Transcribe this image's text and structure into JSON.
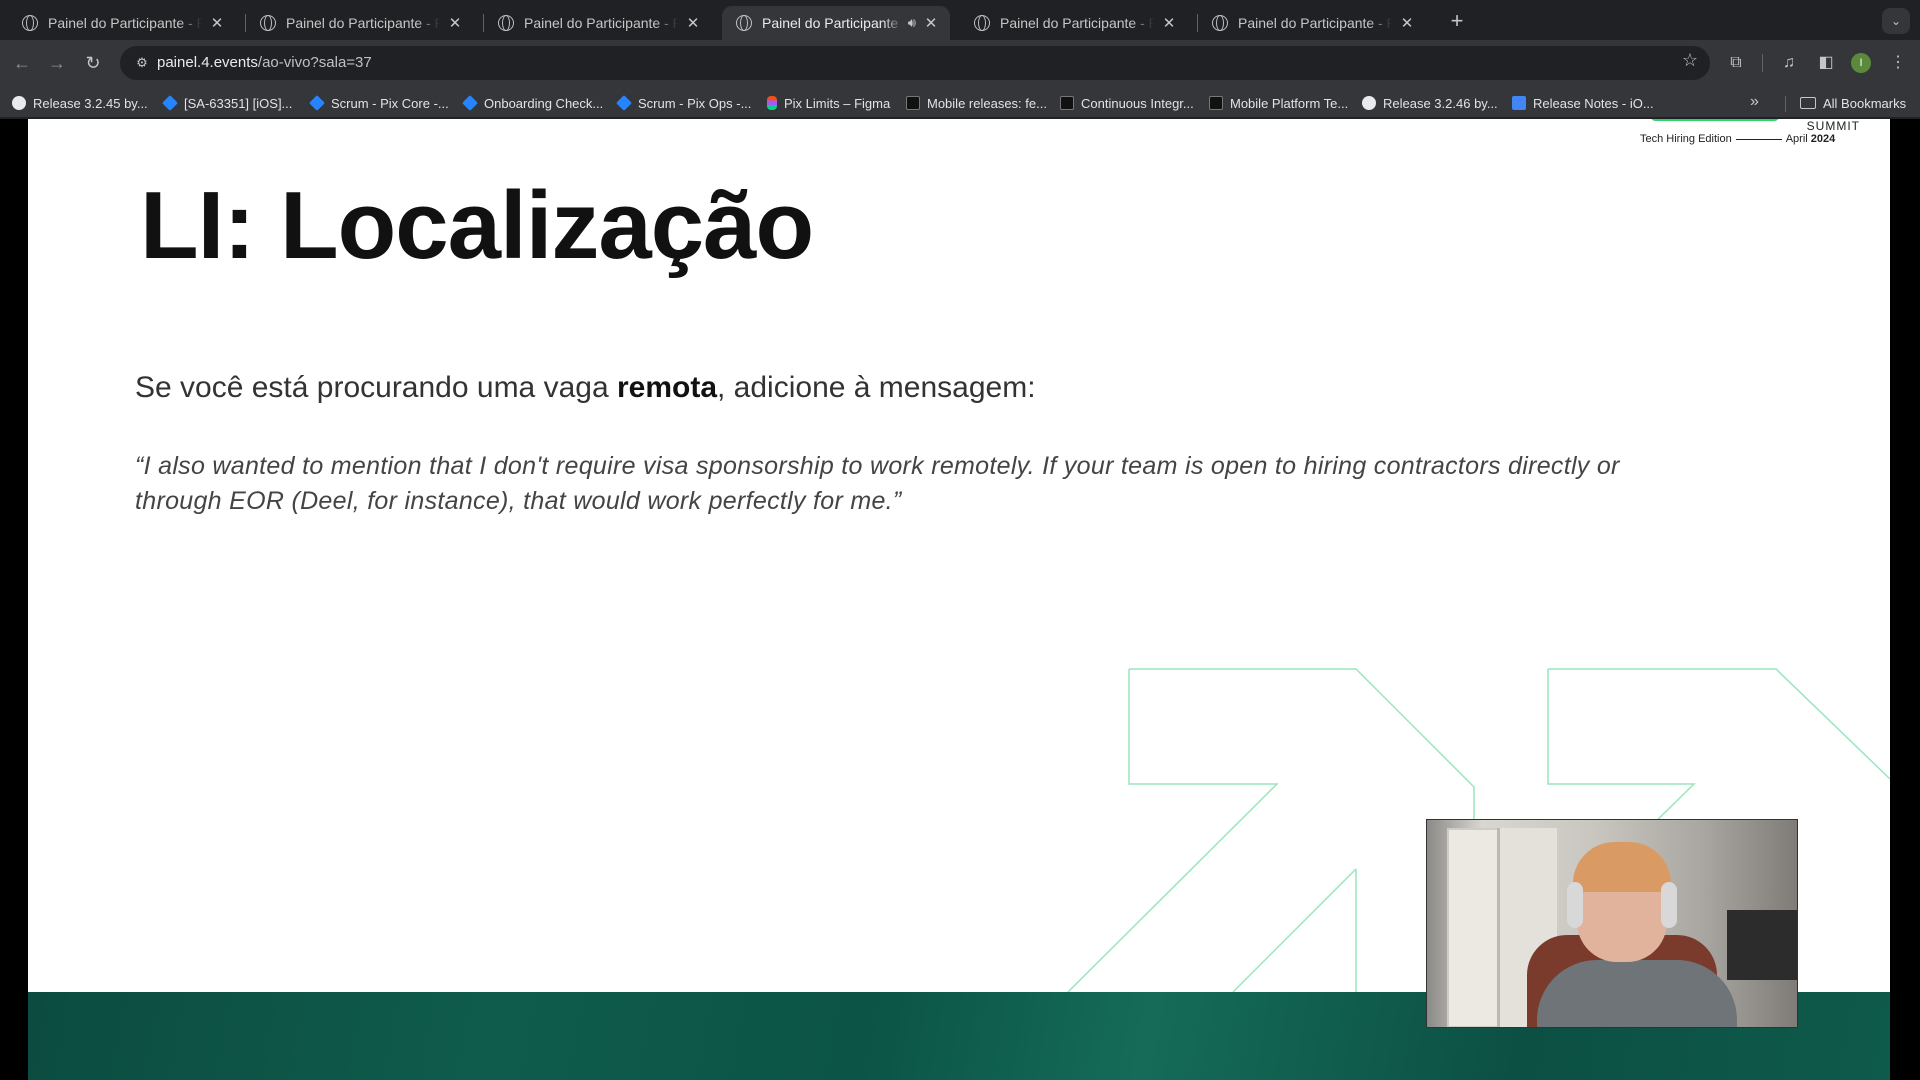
{
  "browser": {
    "tabs": [
      {
        "title": "Painel do Participante - Powe",
        "active": false
      },
      {
        "title": "Painel do Participante - Powe",
        "active": false
      },
      {
        "title": "Painel do Participante - Powe",
        "active": false
      },
      {
        "title": "Painel do Participante - Po",
        "active": true,
        "audio": true
      },
      {
        "title": "Painel do Participante - Powe",
        "active": false
      },
      {
        "title": "Painel do Participante - Powe",
        "active": false
      }
    ],
    "url": {
      "host": "painel.4.events",
      "path": "/ao-vivo?sala=37"
    },
    "avatar_letter": "I",
    "bookmarks": [
      {
        "label": "Release 3.2.45 by...",
        "icon": "github-icon"
      },
      {
        "label": "[SA-63351] [iOS]...",
        "icon": "jira-icon"
      },
      {
        "label": "Scrum - Pix Core -...",
        "icon": "jira-icon"
      },
      {
        "label": "Onboarding Check...",
        "icon": "confluence-icon"
      },
      {
        "label": "Scrum - Pix Ops -...",
        "icon": "jira-icon"
      },
      {
        "label": "Pix Limits – Figma",
        "icon": "figma-icon"
      },
      {
        "label": "Mobile releases: fe...",
        "icon": "app-icon"
      },
      {
        "label": "Continuous Integr...",
        "icon": "app-icon"
      },
      {
        "label": "Mobile Platform Te...",
        "icon": "app-icon"
      },
      {
        "label": "Release 3.2.46 by...",
        "icon": "github-icon"
      },
      {
        "label": "Release Notes - iO...",
        "icon": "docs-icon"
      }
    ],
    "all_bookmarks_label": "All Bookmarks"
  },
  "slide": {
    "logo": {
      "summit": "SUMMIT",
      "edition": "Tech Hiring Edition",
      "month": "April",
      "year": "2024"
    },
    "title": "LI: Localização",
    "subtitle_pre": "Se você está procurando uma vaga ",
    "subtitle_bold": "remota",
    "subtitle_post": ", adicione à mensagem:",
    "quote": "“I also wanted to mention that I don't require visa sponsorship to work remotely. If your team is open to hiring contractors directly or through EOR (Deel, for instance), that would work perfectly for me.”",
    "accent_color": "#2dd46b",
    "footer_color": "#0d5546"
  }
}
